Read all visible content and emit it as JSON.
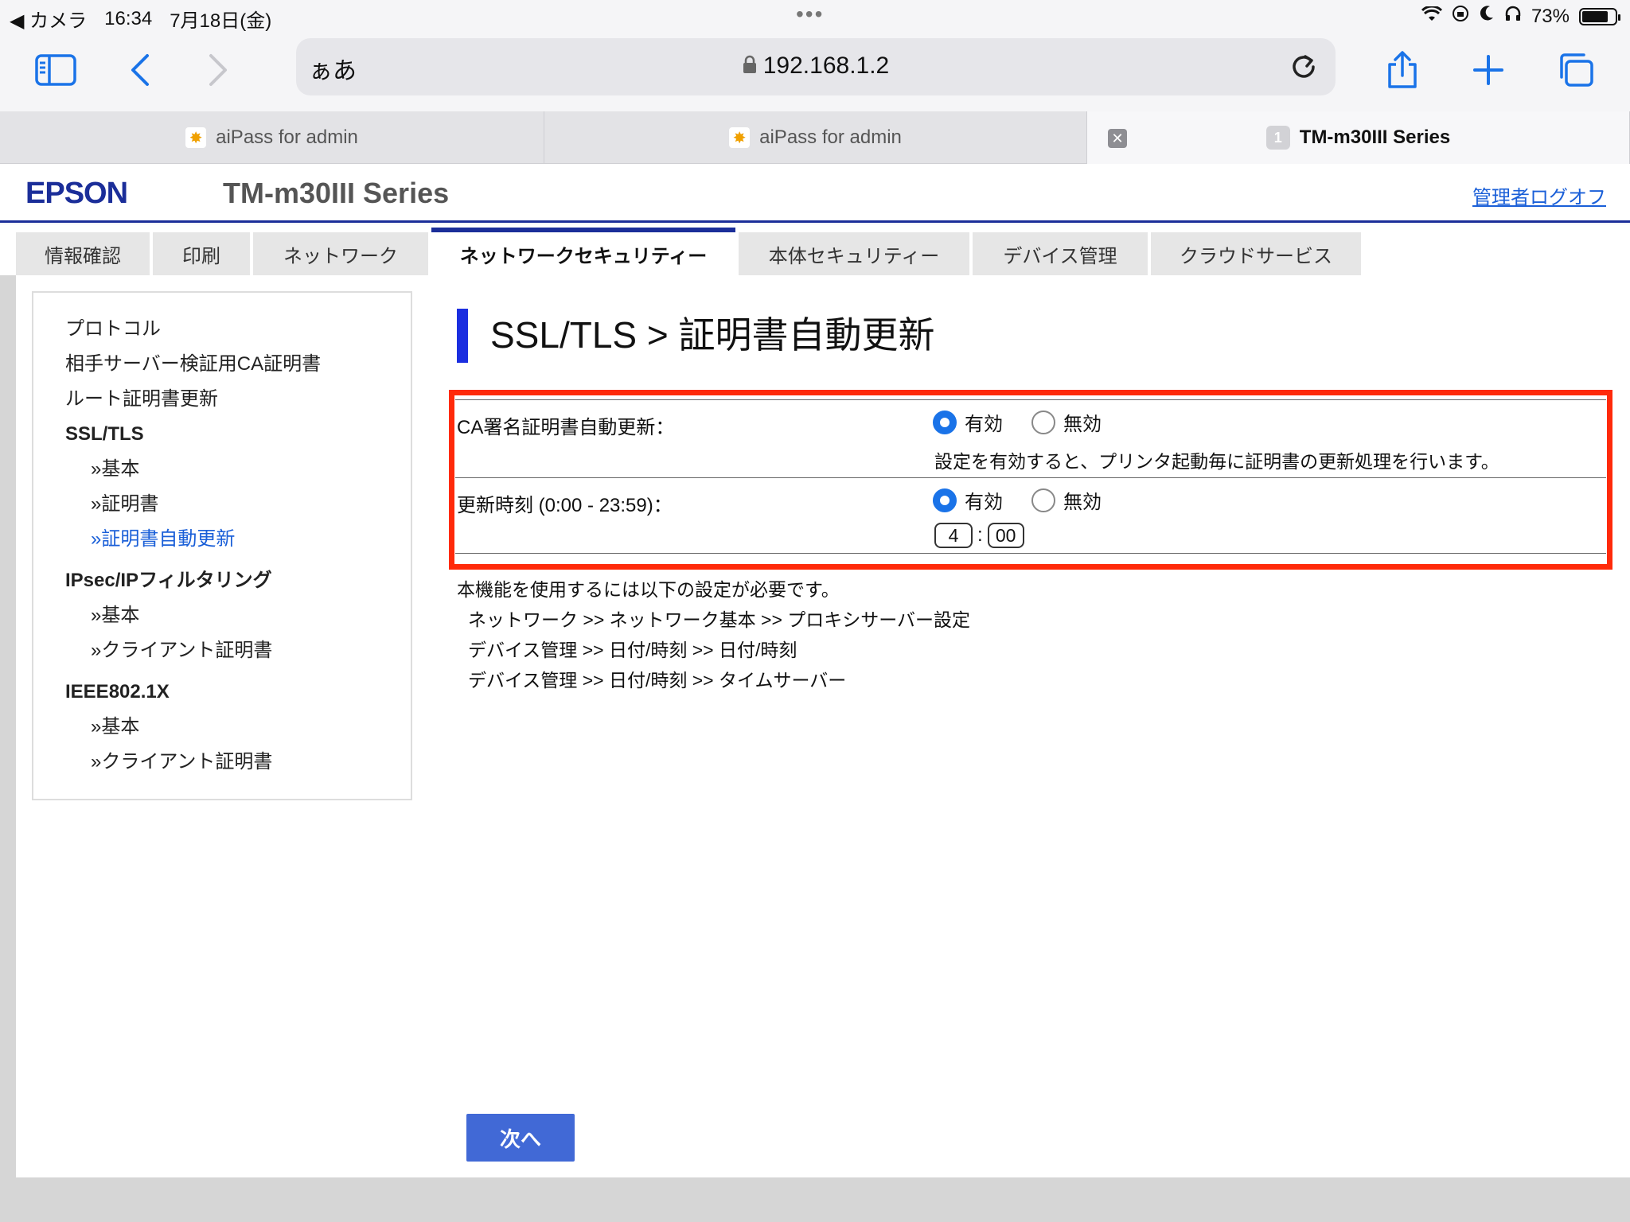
{
  "status_bar": {
    "back_app": "◀ カメラ",
    "time": "16:34",
    "date": "7月18日(金)",
    "dots": "•••",
    "battery": "73%"
  },
  "toolbar": {
    "aa": "ぁあ",
    "url": "192.168.1.2"
  },
  "tabs": [
    {
      "title": "aiPass for admin"
    },
    {
      "title": "aiPass for admin"
    },
    {
      "title": "TM-m30III Series",
      "count": "1"
    }
  ],
  "header": {
    "logo": "EPSON",
    "model": "TM-m30III Series",
    "logoff": "管理者ログオフ"
  },
  "nav": [
    {
      "label": "情報確認"
    },
    {
      "label": "印刷"
    },
    {
      "label": "ネットワーク"
    },
    {
      "label": "ネットワークセキュリティー"
    },
    {
      "label": "本体セキュリティー"
    },
    {
      "label": "デバイス管理"
    },
    {
      "label": "クラウドサービス"
    }
  ],
  "sidebar": {
    "protocol": "プロトコル",
    "ca_cert": "相手サーバー検証用CA証明書",
    "root_update": "ルート証明書更新",
    "ssl_tls": "SSL/TLS",
    "ssl_basic": "»基本",
    "ssl_cert": "»証明書",
    "ssl_auto": "»証明書自動更新",
    "ipsec": "IPsec/IPフィルタリング",
    "ipsec_basic": "»基本",
    "ipsec_client": "»クライアント証明書",
    "ieee": "IEEE802.1X",
    "ieee_basic": "»基本",
    "ieee_client": "»クライアント証明書"
  },
  "page": {
    "heading": "SSL/TLS > 証明書自動更新",
    "auto_update_label": "CA署名証明書自動更新：",
    "enable": "有効",
    "disable": "無効",
    "auto_update_note": "設定を有効すると、プリンタ起動毎に証明書の更新処理を行います。",
    "time_label": "更新時刻 (0:00 - 23:59)：",
    "hour": "4",
    "minute": "00",
    "time_sep": ":",
    "req_title": "本機能を使用するには以下の設定が必要です。",
    "req_1": "ネットワーク >> ネットワーク基本 >> プロキシサーバー設定",
    "req_2": "デバイス管理 >> 日付/時刻 >> 日付/時刻",
    "req_3": "デバイス管理 >> 日付/時刻 >> タイムサーバー",
    "next": "次へ"
  }
}
